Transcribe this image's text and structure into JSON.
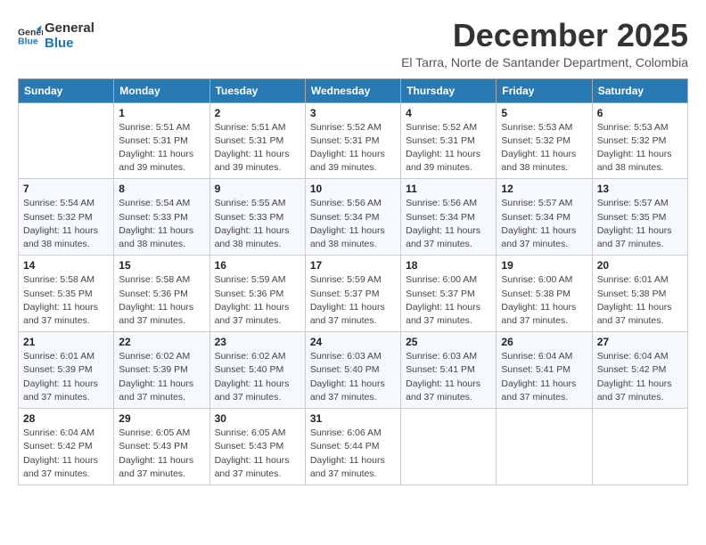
{
  "logo": {
    "line1": "General",
    "line2": "Blue"
  },
  "title": "December 2025",
  "subtitle": "El Tarra, Norte de Santander Department, Colombia",
  "days_header": [
    "Sunday",
    "Monday",
    "Tuesday",
    "Wednesday",
    "Thursday",
    "Friday",
    "Saturday"
  ],
  "weeks": [
    [
      {
        "day": "",
        "info": ""
      },
      {
        "day": "1",
        "info": "Sunrise: 5:51 AM\nSunset: 5:31 PM\nDaylight: 11 hours\nand 39 minutes."
      },
      {
        "day": "2",
        "info": "Sunrise: 5:51 AM\nSunset: 5:31 PM\nDaylight: 11 hours\nand 39 minutes."
      },
      {
        "day": "3",
        "info": "Sunrise: 5:52 AM\nSunset: 5:31 PM\nDaylight: 11 hours\nand 39 minutes."
      },
      {
        "day": "4",
        "info": "Sunrise: 5:52 AM\nSunset: 5:31 PM\nDaylight: 11 hours\nand 39 minutes."
      },
      {
        "day": "5",
        "info": "Sunrise: 5:53 AM\nSunset: 5:32 PM\nDaylight: 11 hours\nand 38 minutes."
      },
      {
        "day": "6",
        "info": "Sunrise: 5:53 AM\nSunset: 5:32 PM\nDaylight: 11 hours\nand 38 minutes."
      }
    ],
    [
      {
        "day": "7",
        "info": "Sunrise: 5:54 AM\nSunset: 5:32 PM\nDaylight: 11 hours\nand 38 minutes."
      },
      {
        "day": "8",
        "info": "Sunrise: 5:54 AM\nSunset: 5:33 PM\nDaylight: 11 hours\nand 38 minutes."
      },
      {
        "day": "9",
        "info": "Sunrise: 5:55 AM\nSunset: 5:33 PM\nDaylight: 11 hours\nand 38 minutes."
      },
      {
        "day": "10",
        "info": "Sunrise: 5:56 AM\nSunset: 5:34 PM\nDaylight: 11 hours\nand 38 minutes."
      },
      {
        "day": "11",
        "info": "Sunrise: 5:56 AM\nSunset: 5:34 PM\nDaylight: 11 hours\nand 37 minutes."
      },
      {
        "day": "12",
        "info": "Sunrise: 5:57 AM\nSunset: 5:34 PM\nDaylight: 11 hours\nand 37 minutes."
      },
      {
        "day": "13",
        "info": "Sunrise: 5:57 AM\nSunset: 5:35 PM\nDaylight: 11 hours\nand 37 minutes."
      }
    ],
    [
      {
        "day": "14",
        "info": "Sunrise: 5:58 AM\nSunset: 5:35 PM\nDaylight: 11 hours\nand 37 minutes."
      },
      {
        "day": "15",
        "info": "Sunrise: 5:58 AM\nSunset: 5:36 PM\nDaylight: 11 hours\nand 37 minutes."
      },
      {
        "day": "16",
        "info": "Sunrise: 5:59 AM\nSunset: 5:36 PM\nDaylight: 11 hours\nand 37 minutes."
      },
      {
        "day": "17",
        "info": "Sunrise: 5:59 AM\nSunset: 5:37 PM\nDaylight: 11 hours\nand 37 minutes."
      },
      {
        "day": "18",
        "info": "Sunrise: 6:00 AM\nSunset: 5:37 PM\nDaylight: 11 hours\nand 37 minutes."
      },
      {
        "day": "19",
        "info": "Sunrise: 6:00 AM\nSunset: 5:38 PM\nDaylight: 11 hours\nand 37 minutes."
      },
      {
        "day": "20",
        "info": "Sunrise: 6:01 AM\nSunset: 5:38 PM\nDaylight: 11 hours\nand 37 minutes."
      }
    ],
    [
      {
        "day": "21",
        "info": "Sunrise: 6:01 AM\nSunset: 5:39 PM\nDaylight: 11 hours\nand 37 minutes."
      },
      {
        "day": "22",
        "info": "Sunrise: 6:02 AM\nSunset: 5:39 PM\nDaylight: 11 hours\nand 37 minutes."
      },
      {
        "day": "23",
        "info": "Sunrise: 6:02 AM\nSunset: 5:40 PM\nDaylight: 11 hours\nand 37 minutes."
      },
      {
        "day": "24",
        "info": "Sunrise: 6:03 AM\nSunset: 5:40 PM\nDaylight: 11 hours\nand 37 minutes."
      },
      {
        "day": "25",
        "info": "Sunrise: 6:03 AM\nSunset: 5:41 PM\nDaylight: 11 hours\nand 37 minutes."
      },
      {
        "day": "26",
        "info": "Sunrise: 6:04 AM\nSunset: 5:41 PM\nDaylight: 11 hours\nand 37 minutes."
      },
      {
        "day": "27",
        "info": "Sunrise: 6:04 AM\nSunset: 5:42 PM\nDaylight: 11 hours\nand 37 minutes."
      }
    ],
    [
      {
        "day": "28",
        "info": "Sunrise: 6:04 AM\nSunset: 5:42 PM\nDaylight: 11 hours\nand 37 minutes."
      },
      {
        "day": "29",
        "info": "Sunrise: 6:05 AM\nSunset: 5:43 PM\nDaylight: 11 hours\nand 37 minutes."
      },
      {
        "day": "30",
        "info": "Sunrise: 6:05 AM\nSunset: 5:43 PM\nDaylight: 11 hours\nand 37 minutes."
      },
      {
        "day": "31",
        "info": "Sunrise: 6:06 AM\nSunset: 5:44 PM\nDaylight: 11 hours\nand 37 minutes."
      },
      {
        "day": "",
        "info": ""
      },
      {
        "day": "",
        "info": ""
      },
      {
        "day": "",
        "info": ""
      }
    ]
  ]
}
